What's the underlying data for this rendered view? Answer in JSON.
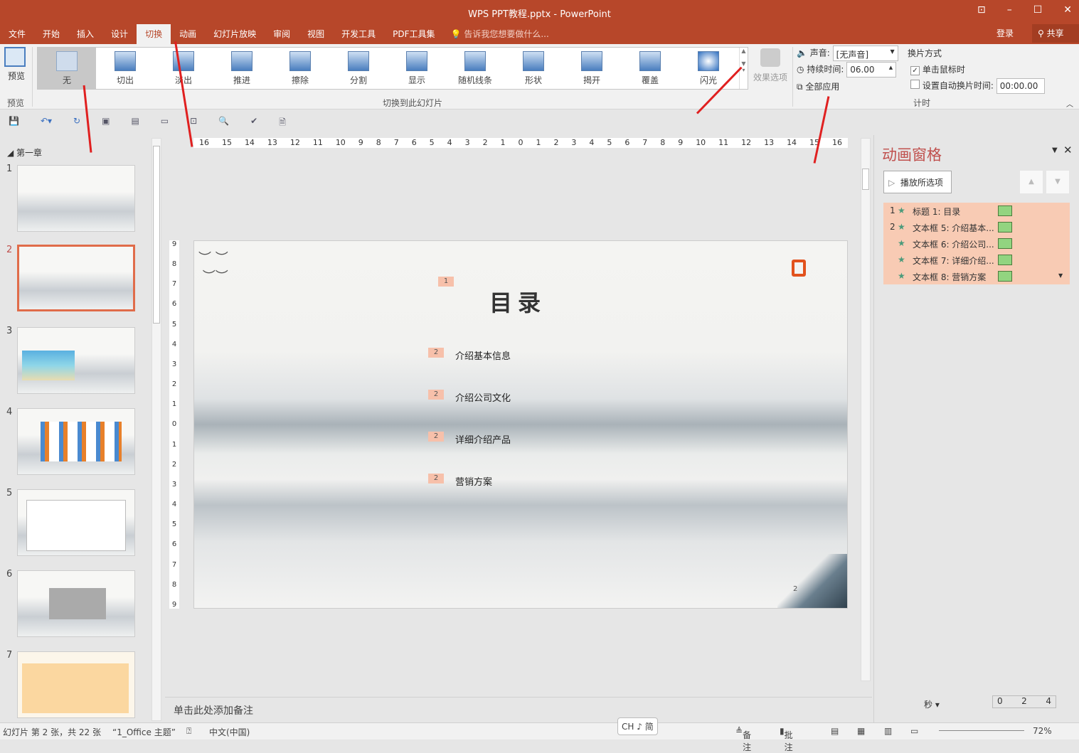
{
  "window": {
    "title": "WPS PPT教程.pptx - PowerPoint",
    "controls": [
      "⊡",
      "–",
      "☐",
      "✕"
    ]
  },
  "menu": {
    "tabs": [
      "文件",
      "开始",
      "插入",
      "设计",
      "切换",
      "动画",
      "幻灯片放映",
      "审阅",
      "视图",
      "开发工具",
      "PDF工具集"
    ],
    "active": "切换",
    "tell_me": "告诉我您想要做什么...",
    "login": "登录",
    "share": "共享"
  },
  "ribbon": {
    "preview": {
      "label": "预览",
      "group": "预览"
    },
    "transitions": [
      "无",
      "切出",
      "淡出",
      "推进",
      "擦除",
      "分割",
      "显示",
      "随机线条",
      "形状",
      "揭开",
      "覆盖",
      "闪光"
    ],
    "selected": "无",
    "group_label": "切换到此幻灯片",
    "effect_options": "效果选项",
    "sound_label": "声音:",
    "sound_value": "[无声音]",
    "duration_label": "持续时间:",
    "duration_value": "06.00",
    "apply_all": "全部应用",
    "advance_label": "换片方式",
    "on_click": "单击鼠标时",
    "on_click_checked": true,
    "auto_label": "设置自动换片时间:",
    "auto_checked": false,
    "auto_value": "00:00.00",
    "timing_group": "计时"
  },
  "sidebar": {
    "section": "第一章",
    "slides": [
      "1",
      "2",
      "3",
      "4",
      "5",
      "6",
      "7"
    ],
    "selected": "2"
  },
  "ruler": {
    "h": [
      "16",
      "15",
      "14",
      "13",
      "12",
      "11",
      "10",
      "9",
      "8",
      "7",
      "6",
      "5",
      "4",
      "3",
      "2",
      "1",
      "0",
      "1",
      "2",
      "3",
      "4",
      "5",
      "6",
      "7",
      "8",
      "9",
      "10",
      "11",
      "12",
      "13",
      "14",
      "15",
      "16"
    ],
    "v": [
      "9",
      "8",
      "7",
      "6",
      "5",
      "4",
      "3",
      "2",
      "1",
      "0",
      "1",
      "2",
      "3",
      "4",
      "5",
      "6",
      "7",
      "8",
      "9"
    ]
  },
  "slide": {
    "title": "目录",
    "title_badge": "1",
    "items": [
      {
        "badge": "2",
        "text": "介绍基本信息"
      },
      {
        "badge": "2",
        "text": "介绍公司文化"
      },
      {
        "badge": "2",
        "text": "详细介绍产品"
      },
      {
        "badge": "2",
        "text": "营销方案"
      }
    ],
    "page_number": "2"
  },
  "notes": {
    "placeholder": "单击此处添加备注"
  },
  "animation_pane": {
    "title": "动画窗格",
    "play_button": "播放所选项",
    "items": [
      {
        "num": "1",
        "label": "标题 1: 目录"
      },
      {
        "num": "2",
        "label": "文本框 5: 介绍基本..."
      },
      {
        "num": "",
        "label": "文本框 6: 介绍公司..."
      },
      {
        "num": "",
        "label": "文本框 7: 详细介绍..."
      },
      {
        "num": "",
        "label": "文本框 8: 营销方案"
      }
    ],
    "seconds": "秒",
    "timeline": [
      "0",
      "2",
      "4"
    ]
  },
  "status": {
    "slide_info": "幻灯片 第 2 张，共 22 张",
    "theme": "“1_Office 主题”",
    "language": "中文(中国)",
    "ime": "CH ♪ 简",
    "notes": "备注",
    "comments": "批注",
    "zoom": "72%"
  },
  "colors": {
    "accent": "#b7472a",
    "pane_title": "#c0504d",
    "anim_list": "#f8cbb4"
  }
}
